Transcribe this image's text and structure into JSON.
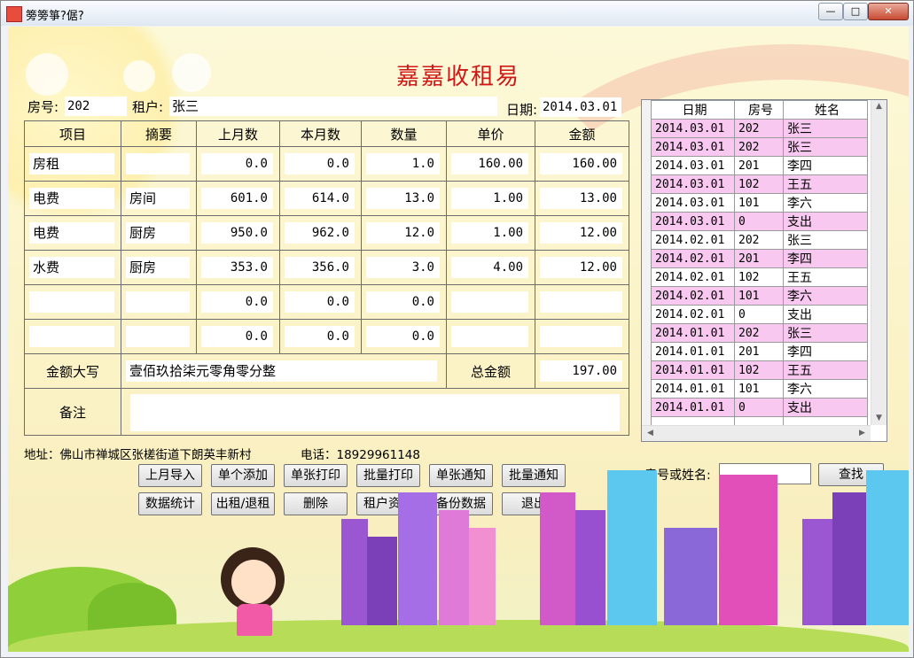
{
  "window": {
    "title": "篣篣箏?倨?",
    "controls": [
      "minimize",
      "maximize",
      "close"
    ]
  },
  "app_title": "嘉嘉收租易",
  "header": {
    "room_label": "房号:",
    "room_value": "202",
    "tenant_label": "租户:",
    "tenant_value": "张三",
    "date_label": "日期:",
    "date_value": "2014.03.01"
  },
  "bill": {
    "columns": [
      "项目",
      "摘要",
      "上月数",
      "本月数",
      "数量",
      "单价",
      "金额"
    ],
    "rows": [
      [
        "房租",
        "",
        "0.0",
        "0.0",
        "1.0",
        "160.00",
        "160.00"
      ],
      [
        "电费",
        "房间",
        "601.0",
        "614.0",
        "13.0",
        "1.00",
        "13.00"
      ],
      [
        "电费",
        "厨房",
        "950.0",
        "962.0",
        "12.0",
        "1.00",
        "12.00"
      ],
      [
        "水费",
        "厨房",
        "353.0",
        "356.0",
        "3.0",
        "4.00",
        "12.00"
      ],
      [
        "",
        "",
        "0.0",
        "0.0",
        "0.0",
        "",
        ""
      ],
      [
        "",
        "",
        "0.0",
        "0.0",
        "0.0",
        "",
        ""
      ]
    ],
    "amount_words_label": "金额大写",
    "amount_words": "壹佰玖拾柒元零角零分整",
    "total_label": "总金额",
    "total_value": "197.00",
    "remark_label": "备注",
    "remark_value": ""
  },
  "records": {
    "columns": [
      "日期",
      "房号",
      "姓名"
    ],
    "rows": [
      {
        "date": "2014.03.01",
        "room": "202",
        "name": "张三",
        "highlight": true
      },
      {
        "date": "2014.03.01",
        "room": "202",
        "name": "张三",
        "highlight": true
      },
      {
        "date": "2014.03.01",
        "room": "201",
        "name": "李四",
        "highlight": false
      },
      {
        "date": "2014.03.01",
        "room": "102",
        "name": "王五",
        "highlight": true
      },
      {
        "date": "2014.03.01",
        "room": "101",
        "name": "李六",
        "highlight": false
      },
      {
        "date": "2014.03.01",
        "room": "0",
        "name": "支出",
        "highlight": true
      },
      {
        "date": "2014.02.01",
        "room": "202",
        "name": "张三",
        "highlight": false
      },
      {
        "date": "2014.02.01",
        "room": "201",
        "name": "李四",
        "highlight": true
      },
      {
        "date": "2014.02.01",
        "room": "102",
        "name": "王五",
        "highlight": false
      },
      {
        "date": "2014.02.01",
        "room": "101",
        "name": "李六",
        "highlight": true
      },
      {
        "date": "2014.02.01",
        "room": "0",
        "name": "支出",
        "highlight": false
      },
      {
        "date": "2014.01.01",
        "room": "202",
        "name": "张三",
        "highlight": true
      },
      {
        "date": "2014.01.01",
        "room": "201",
        "name": "李四",
        "highlight": false
      },
      {
        "date": "2014.01.01",
        "room": "102",
        "name": "王五",
        "highlight": true
      },
      {
        "date": "2014.01.01",
        "room": "101",
        "name": "李六",
        "highlight": false
      },
      {
        "date": "2014.01.01",
        "room": "0",
        "name": "支出",
        "highlight": true
      }
    ]
  },
  "footer": {
    "address": "地址：佛山市禅城区张槎街道下朗英丰新村",
    "phone": "电话：18929961148"
  },
  "buttons_row1": [
    "上月导入",
    "单个添加",
    "单张打印",
    "批量打印",
    "单张通知",
    "批量通知"
  ],
  "buttons_row2": [
    "数据统计",
    "出租/退租",
    "删除",
    "租户资料",
    "备份数据",
    "退出"
  ],
  "search": {
    "label": "房号或姓名:",
    "value": "",
    "button": "查找"
  },
  "colors": {
    "title_red": "#d01818",
    "row_pink": "#f8c8f0",
    "background": "#fcf9d8"
  }
}
